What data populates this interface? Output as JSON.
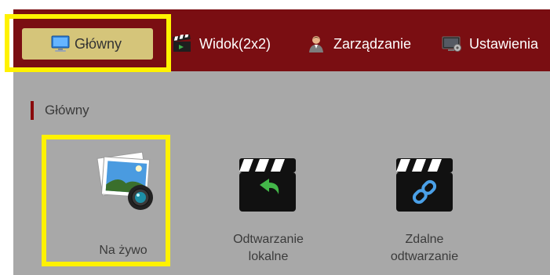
{
  "topbar": {
    "tabs": [
      {
        "label": "Główny",
        "icon": "monitor-icon",
        "active": true
      },
      {
        "label": "Widok(2x2)",
        "icon": "clapperboard-icon",
        "active": false
      },
      {
        "label": "Zarządzanie",
        "icon": "user-icon",
        "active": false
      },
      {
        "label": "Ustawienia",
        "icon": "settings-monitor-icon",
        "active": false
      }
    ]
  },
  "section": {
    "title": "Główny"
  },
  "items": [
    {
      "label": "Na żywo",
      "icon": "live-photo-camera-icon"
    },
    {
      "label_line1": "Odtwarzanie",
      "label_line2": "lokalne",
      "icon": "local-playback-icon"
    },
    {
      "label_line1": "Zdalne",
      "label_line2": "odtwarzanie",
      "icon": "remote-playback-icon"
    }
  ],
  "colors": {
    "topbar": "#7a0e12",
    "background": "#a8a8a8",
    "active_tab": "#d5c57a",
    "highlight": "#fff200",
    "section_bar": "#8a0a0c"
  }
}
